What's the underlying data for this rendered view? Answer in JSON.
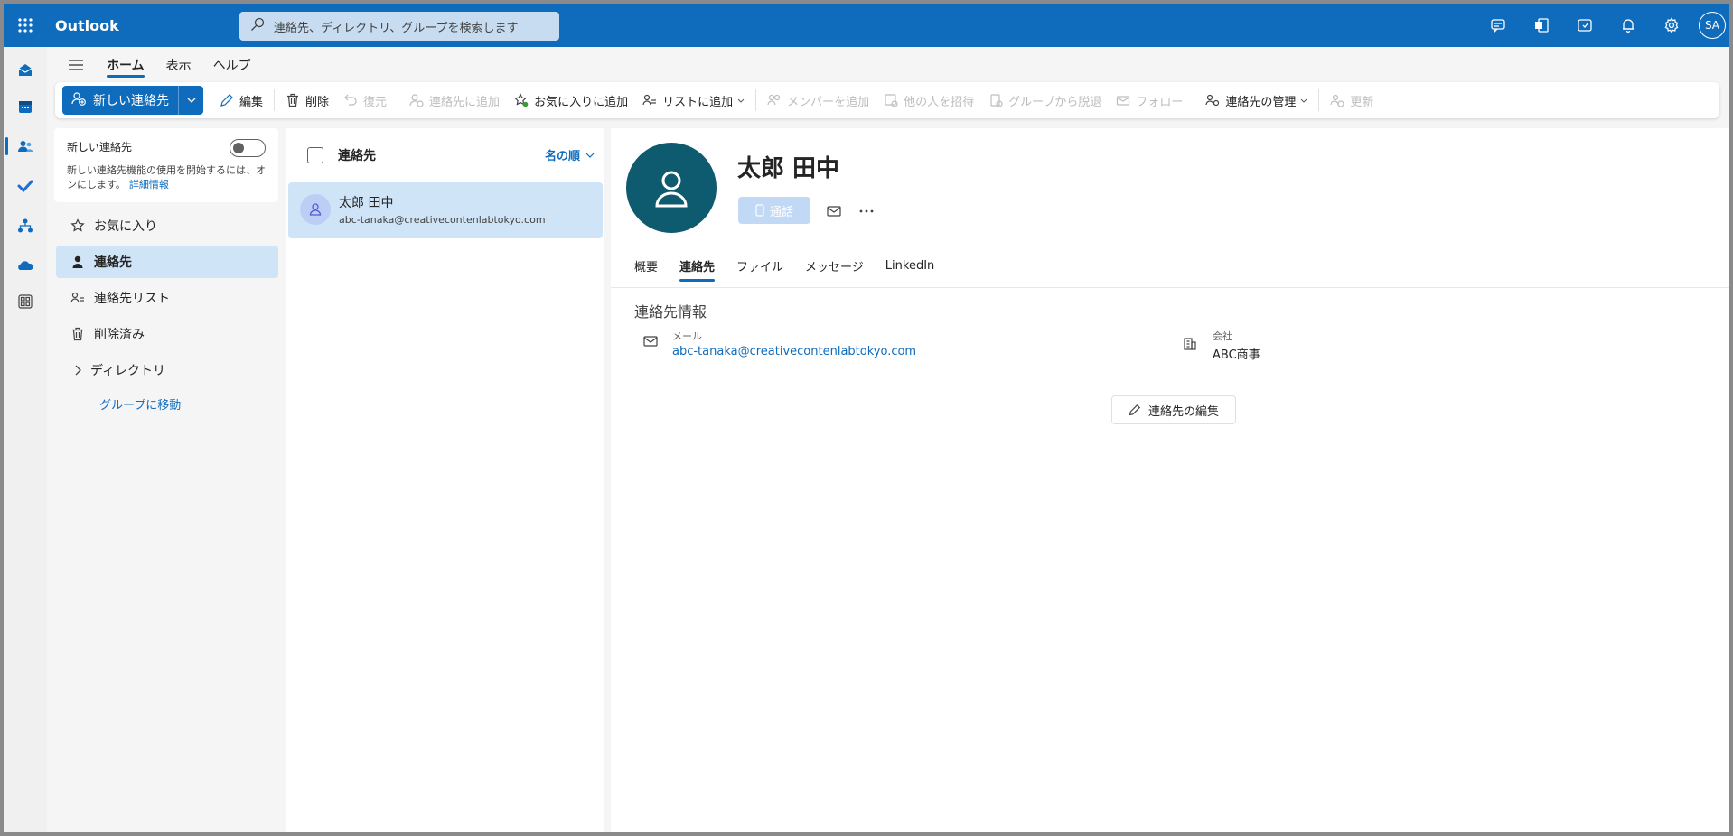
{
  "app": {
    "title": "Outlook",
    "user_initials": "SA"
  },
  "search": {
    "placeholder": "連絡先、ディレクトリ、グループを検索します"
  },
  "ribbon": {
    "tabs": [
      {
        "label": "ホーム",
        "active": true
      },
      {
        "label": "表示"
      },
      {
        "label": "ヘルプ"
      }
    ]
  },
  "toolbar": {
    "new_contact": "新しい連絡先",
    "edit": "編集",
    "delete": "削除",
    "restore": "復元",
    "add_to_contacts": "連絡先に追加",
    "add_to_favorites": "お気に入りに追加",
    "add_to_list": "リストに追加",
    "add_member": "メンバーを追加",
    "invite_others": "他の人を招待",
    "leave_group": "グループから脱退",
    "follow": "フォロー",
    "manage_contacts": "連絡先の管理",
    "update": "更新"
  },
  "leftnav": {
    "new_contacts_title": "新しい連絡先",
    "new_contacts_desc": "新しい連絡先機能の使用を開始するには、オンにします。",
    "learn_more": "詳細情報",
    "items": [
      {
        "label": "お気に入り"
      },
      {
        "label": "連絡先"
      },
      {
        "label": "連絡先リスト"
      },
      {
        "label": "削除済み"
      },
      {
        "label": "ディレクトリ"
      }
    ],
    "go_to_groups": "グループに移動"
  },
  "list": {
    "title": "連絡先",
    "sort": "名の順",
    "contacts": [
      {
        "name": "太郎 田中",
        "email": "abc-tanaka@creativecontenlabtokyo.com"
      }
    ]
  },
  "detail": {
    "name": "太郎 田中",
    "call": "通話",
    "tabs": [
      {
        "label": "概要"
      },
      {
        "label": "連絡先",
        "active": true
      },
      {
        "label": "ファイル"
      },
      {
        "label": "メッセージ"
      },
      {
        "label": "LinkedIn"
      }
    ],
    "section_title": "連絡先情報",
    "email_label": "メール",
    "email_value": "abc-tanaka@creativecontenlabtokyo.com",
    "company_label": "会社",
    "company_value": "ABC商事",
    "edit_contact": "連絡先の編集"
  },
  "colors": {
    "accent": "#0f6cbd",
    "avatar": "#0e5a6e",
    "selected": "#d0e4f7"
  }
}
